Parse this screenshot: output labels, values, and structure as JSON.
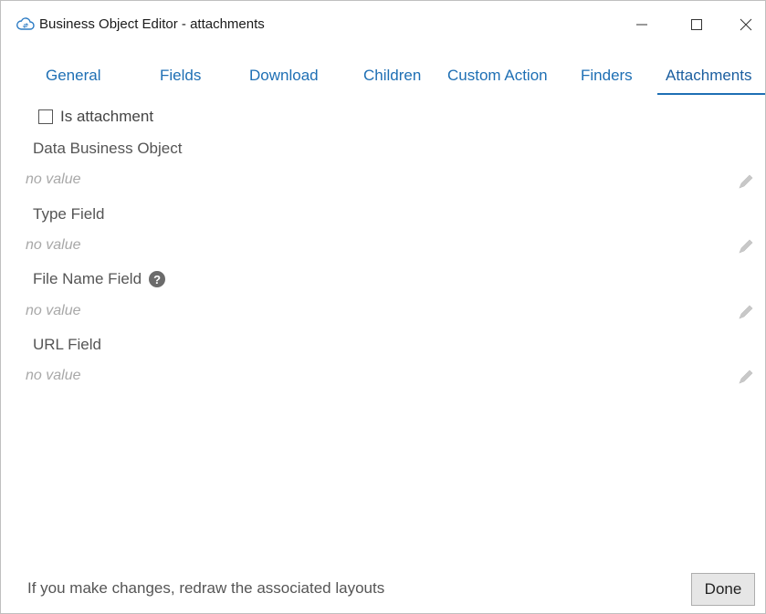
{
  "window": {
    "title": "Business Object Editor - attachments",
    "minimize_glyph": "—",
    "maximize_glyph": "☐",
    "close_glyph": "✕"
  },
  "tabs": [
    {
      "label": "General",
      "active": false
    },
    {
      "label": "Fields",
      "active": false
    },
    {
      "label": "Download",
      "active": false
    },
    {
      "label": "Children",
      "active": false
    },
    {
      "label": "Custom Action",
      "active": false
    },
    {
      "label": "Finders",
      "active": false
    },
    {
      "label": "Attachments",
      "active": true
    }
  ],
  "is_attachment": {
    "label": "Is attachment",
    "checked": false
  },
  "fields": [
    {
      "label": "Data Business Object",
      "value": "no value",
      "has_help": false
    },
    {
      "label": "Type Field",
      "value": "no value",
      "has_help": false
    },
    {
      "label": "File Name Field",
      "value": "no value",
      "has_help": true
    },
    {
      "label": "URL Field",
      "value": "no value",
      "has_help": false
    }
  ],
  "help_glyph": "?",
  "footer": {
    "message": "If you make changes, redraw the associated layouts",
    "done_label": "Done"
  },
  "colors": {
    "accent": "#1e6fb4",
    "placeholder": "#a8a8a8",
    "button_bg": "#e6e6e6"
  },
  "icons": {
    "app": "cloud-sync-icon",
    "edit": "pencil-icon",
    "help": "question-circle-icon"
  }
}
